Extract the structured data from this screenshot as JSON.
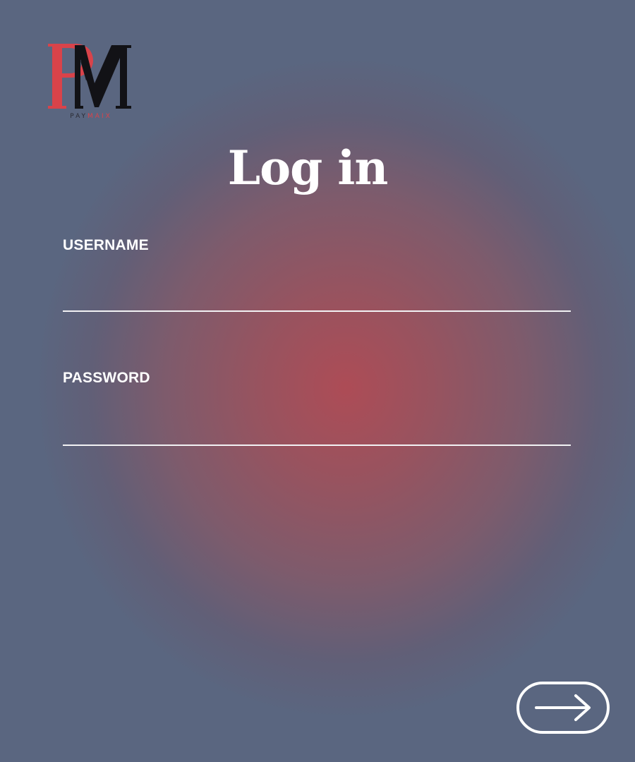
{
  "brand": {
    "logo_letters": "PM",
    "logo_subtext_prefix": "PAY",
    "logo_subtext_suffix": "MAIX",
    "colors": {
      "red": "#d9434a",
      "black": "#121216"
    }
  },
  "page": {
    "title": "Log in"
  },
  "form": {
    "username": {
      "label": "USERNAME",
      "value": "",
      "placeholder": ""
    },
    "password": {
      "label": "PASSWORD",
      "value": "",
      "placeholder": ""
    },
    "submit": {
      "icon": "arrow-right-icon",
      "aria_label": "Submit"
    }
  },
  "colors": {
    "text": "#ffffff",
    "background_edge": "#5a6680",
    "background_center": "#ad4c56"
  }
}
